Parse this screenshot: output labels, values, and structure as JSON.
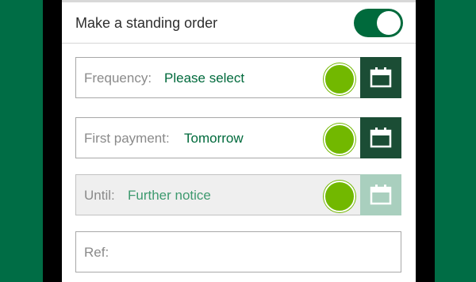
{
  "standing_order": {
    "label": "Make a standing order",
    "enabled": true
  },
  "fields": {
    "frequency": {
      "label": "Frequency:",
      "value": "Please select"
    },
    "first_payment": {
      "label": "First payment:",
      "value": "Tomorrow"
    },
    "until": {
      "label": "Until:",
      "value": "Further notice"
    },
    "ref": {
      "label": "Ref:",
      "value": ""
    }
  },
  "icons": {
    "calendar": "calendar-icon",
    "indicator": "green-dot"
  },
  "colors": {
    "brand_green": "#006d45",
    "accent_green": "#72b800",
    "value_text": "#006a3c",
    "calendar_button": "#1b4d35"
  }
}
